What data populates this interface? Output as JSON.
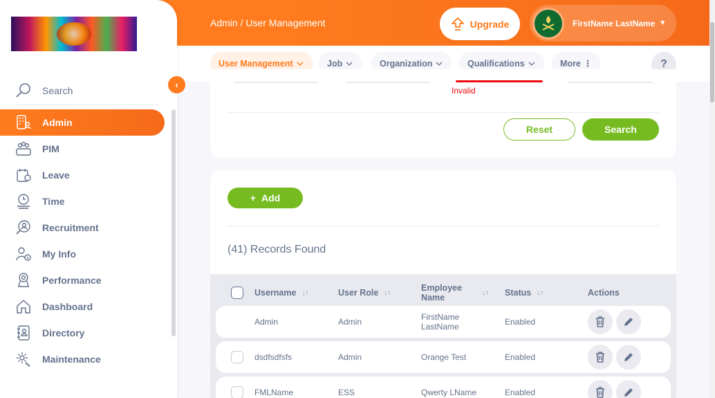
{
  "header": {
    "breadcrumb": "Admin / User Management",
    "upgrade_label": "Upgrade",
    "user_name": "FirstName LastName"
  },
  "subnav": {
    "tabs": [
      {
        "label": "User Management",
        "icon": "chevron-down-icon"
      },
      {
        "label": "Job",
        "icon": "chevron-down-icon"
      },
      {
        "label": "Organization",
        "icon": "chevron-down-icon"
      },
      {
        "label": "Qualifications",
        "icon": "chevron-down-icon"
      },
      {
        "label": "More",
        "icon": "more-vertical-icon"
      }
    ],
    "help_label": "?"
  },
  "sidebar": {
    "search_label": "Search",
    "items": [
      {
        "label": "Admin",
        "icon": "admin-icon",
        "active": true
      },
      {
        "label": "PIM",
        "icon": "pim-icon"
      },
      {
        "label": "Leave",
        "icon": "leave-icon"
      },
      {
        "label": "Time",
        "icon": "time-icon"
      },
      {
        "label": "Recruitment",
        "icon": "recruitment-icon"
      },
      {
        "label": "My Info",
        "icon": "my-info-icon"
      },
      {
        "label": "Performance",
        "icon": "performance-icon"
      },
      {
        "label": "Dashboard",
        "icon": "dashboard-icon"
      },
      {
        "label": "Directory",
        "icon": "directory-icon"
      },
      {
        "label": "Maintenance",
        "icon": "maintenance-icon"
      }
    ]
  },
  "filter": {
    "invalid_message": "Invalid",
    "reset_label": "Reset",
    "search_label": "Search"
  },
  "records": {
    "add_label": "Add",
    "add_icon": "+",
    "found_text": "(41) Records Found",
    "columns": [
      "Username",
      "User Role",
      "Employee Name",
      "Status",
      "Actions"
    ],
    "rows": [
      {
        "username": "Admin",
        "role": "Admin",
        "employee": "FirstName LastName",
        "status": "Enabled",
        "selectable": false
      },
      {
        "username": "dsdfsdfsfs",
        "role": "Admin",
        "employee": "Orange Test",
        "status": "Enabled",
        "selectable": true
      },
      {
        "username": "FMLName",
        "role": "ESS",
        "employee": "Qwerty LName",
        "status": "Enabled",
        "selectable": true
      }
    ]
  },
  "colors": {
    "brand_orange": "#ff7b1d",
    "action_green": "#76bc21",
    "error_red": "#eb0910",
    "text_gray": "#64728c"
  }
}
